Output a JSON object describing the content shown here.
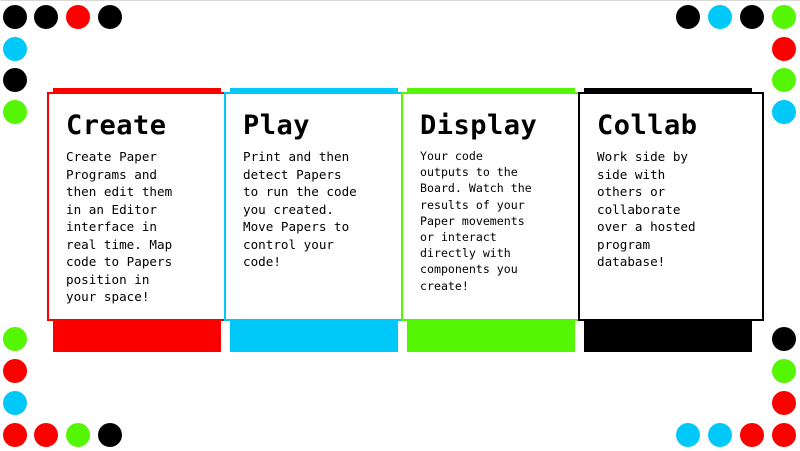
{
  "colors": {
    "red": "#fc0000",
    "blue": "#00c8f8",
    "green": "#55f603",
    "black": "#000000"
  },
  "cards": [
    {
      "title": "Create",
      "body": "Create Paper\nPrograms and\nthen edit them\nin an Editor\ninterface in\nreal time. Map\ncode to Papers\nposition in\nyour space!",
      "color": "#fc0000"
    },
    {
      "title": "Play",
      "body": "Print and then\ndetect Papers\nto run the code\nyou created.\nMove Papers to\ncontrol your\ncode!",
      "color": "#00c8f8"
    },
    {
      "title": "Display",
      "body": "Your code\noutputs to the\nBoard. Watch the\nresults of your\nPaper movements\nor interact\ndirectly with\ncomponents you\ncreate!",
      "color": "#55f603"
    },
    {
      "title": "Collab",
      "body": "Work side by\nside with\nothers or\ncollaborate\nover a hosted\nprogram\ndatabase!",
      "color": "#000000"
    }
  ]
}
